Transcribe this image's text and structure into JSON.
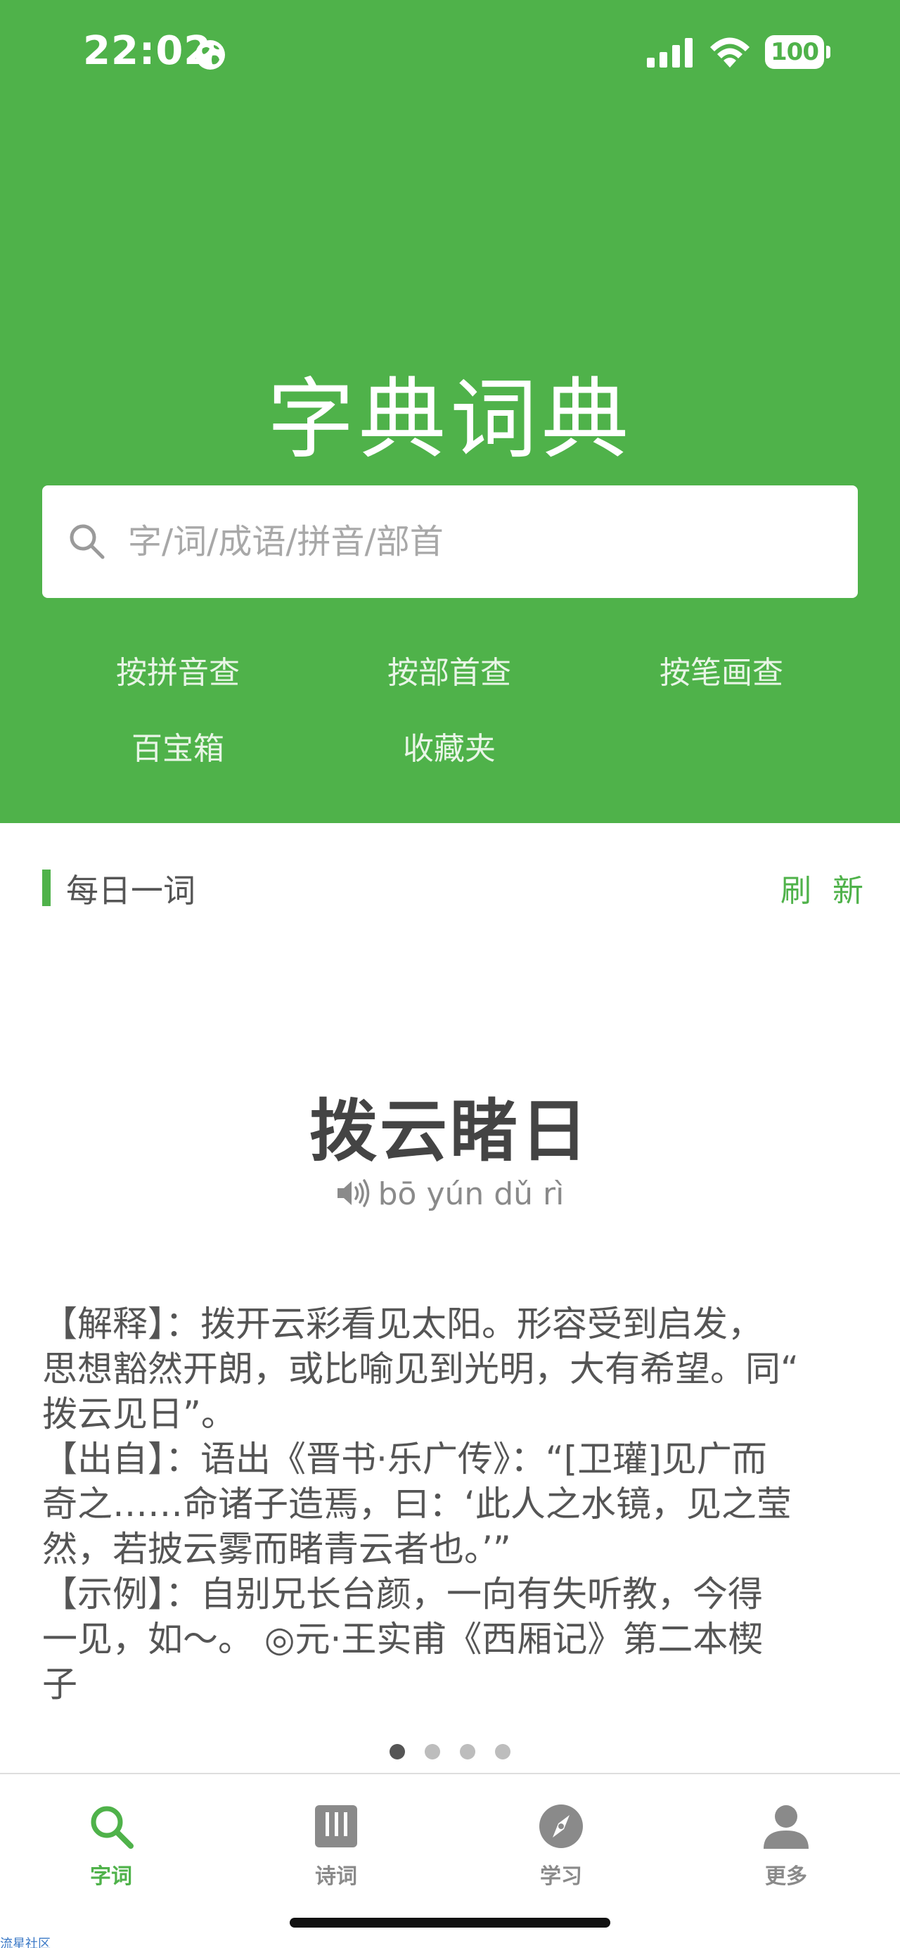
{
  "status_bar": {
    "time": "22:02",
    "battery": "100"
  },
  "header": {
    "title": "字典词典",
    "search_placeholder": "字/词/成语/拼音/部首",
    "quick_links": [
      "按拼音查",
      "按部首查",
      "按笔画查",
      "百宝箱",
      "收藏夹"
    ]
  },
  "daily_word": {
    "section_title": "每日一词",
    "refresh_label": "刷 新",
    "word": "拨云睹日",
    "pinyin": "bō yún dǔ rì",
    "definition_lines": [
      "【解释】：拨开云彩看见太阳。形容受到启发，",
      "思想豁然开朗，或比喻见到光明，大有希望。同“",
      "拨云见日”。",
      "【出自】：语出《晋书·乐广传》：“[卫瓘]见广而",
      "奇之……命诸子造焉，曰：‘此人之水镜，见之莹",
      "然，若披云雾而睹青云者也。’”",
      "【示例】：自别兄长台颜，一向有失听教，今得",
      "一见，如～。 ◎元·王实甫《西厢记》第二本楔",
      "子"
    ],
    "pager": {
      "count": 4,
      "active_index": 0
    }
  },
  "tabbar": {
    "tabs": [
      {
        "label": "字词",
        "icon": "search-icon",
        "active": true
      },
      {
        "label": "诗词",
        "icon": "book-icon",
        "active": false
      },
      {
        "label": "学习",
        "icon": "compass-icon",
        "active": false
      },
      {
        "label": "更多",
        "icon": "person-icon",
        "active": false
      }
    ]
  },
  "watermark": "流星社区",
  "colors": {
    "brand_green": "#4fb24a",
    "text_gray": "#555555",
    "inactive_gray": "#8a8a8a"
  }
}
